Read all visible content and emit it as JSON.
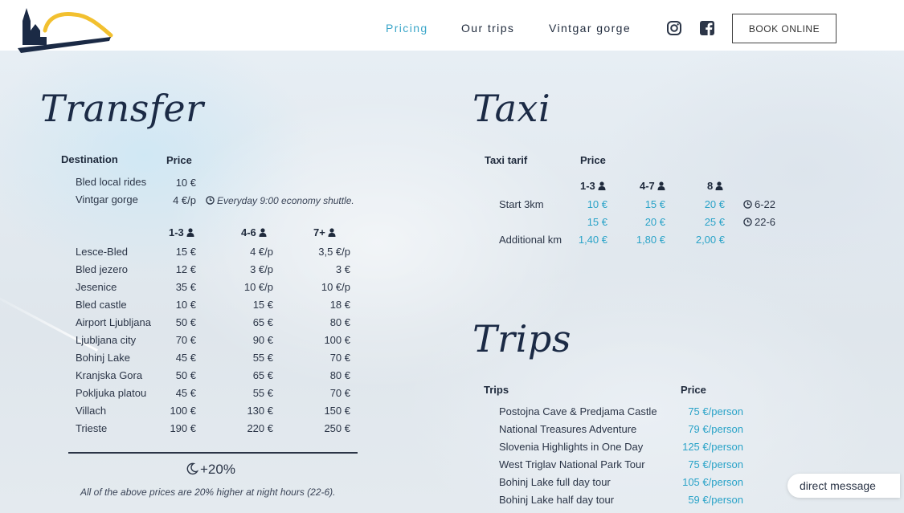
{
  "nav": {
    "pricing": "Pricing",
    "our_trips": "Our trips",
    "vintgar": "Vintgar gorge",
    "book": "BOOK ONLINE",
    "icons": [
      "instagram-icon",
      "facebook-icon"
    ]
  },
  "colors": {
    "accent": "#2aa3c8",
    "dark": "#1f2a3c",
    "logo_yellow": "#f2c02f"
  },
  "transfer": {
    "title": "Transfer",
    "col_destination": "Destination",
    "col_price": "Price",
    "local": [
      {
        "name": "Bled local rides",
        "price": "10 €",
        "note": ""
      },
      {
        "name": "Vintgar gorge",
        "price": "4 €/p",
        "note": "Everyday 9:00 economy shuttle."
      }
    ],
    "group_headers": [
      "1-3",
      "4-6",
      "7+"
    ],
    "rows": [
      {
        "name": "Lesce-Bled",
        "p1": "15 €",
        "p2": "4 €/p",
        "p3": "3,5 €/p"
      },
      {
        "name": "Bled jezero",
        "p1": "12 €",
        "p2": "3 €/p",
        "p3": "3 €"
      },
      {
        "name": "Jesenice",
        "p1": "35 €",
        "p2": "10 €/p",
        "p3": "10 €/p"
      },
      {
        "name": "Bled castle",
        "p1": "10 €",
        "p2": "15 €",
        "p3": "18 €"
      },
      {
        "name": "Airport Ljubljana",
        "p1": "50 €",
        "p2": "65 €",
        "p3": "80 €"
      },
      {
        "name": "Ljubljana city",
        "p1": "70 €",
        "p2": "90 €",
        "p3": "100 €"
      },
      {
        "name": "Bohinj Lake",
        "p1": "45 €",
        "p2": "55 €",
        "p3": "70 €"
      },
      {
        "name": "Kranjska Gora",
        "p1": "50 €",
        "p2": "65 €",
        "p3": "80 €"
      },
      {
        "name": "Pokljuka platou",
        "p1": "45 €",
        "p2": "55 €",
        "p3": "70 €"
      },
      {
        "name": "Villach",
        "p1": "100 €",
        "p2": "130 €",
        "p3": "150 €"
      },
      {
        "name": "Trieste",
        "p1": "190 €",
        "p2": "220 €",
        "p3": "250 €"
      }
    ],
    "night_label": "+20%",
    "night_note": "All of the above prices are 20% higher at night hours (22-6)."
  },
  "taxi": {
    "title": "Taxi",
    "col_tarif": "Taxi tarif",
    "col_price": "Price",
    "group_headers": [
      "1-3",
      "4-7",
      "8"
    ],
    "rows": [
      {
        "label": "Start 3km",
        "p1": "10 €",
        "p2": "15 €",
        "p3": "20 €",
        "hours": "6-22"
      },
      {
        "label": "",
        "p1": "15 €",
        "p2": "20 €",
        "p3": "25 €",
        "hours": "22-6"
      },
      {
        "label": "Additional km",
        "p1": "1,40 €",
        "p2": "1,80 €",
        "p3": "2,00 €",
        "hours": ""
      }
    ]
  },
  "trips": {
    "title": "Trips",
    "col_trips": "Trips",
    "col_price": "Price",
    "rows": [
      {
        "name": "Postojna Cave & Predjama Castle",
        "price": "75 €/person"
      },
      {
        "name": "National Treasures Adventure",
        "price": "79 €/person"
      },
      {
        "name": "Slovenia Highlights in One Day",
        "price": "125 €/person"
      },
      {
        "name": "West Triglav National Park Tour",
        "price": "75 €/person"
      },
      {
        "name": "Bohinj Lake full day tour",
        "price": "105 €/person"
      },
      {
        "name": "Bohinj Lake half day tour",
        "price": "59 €/person"
      }
    ]
  },
  "chat": {
    "label": "direct message"
  }
}
